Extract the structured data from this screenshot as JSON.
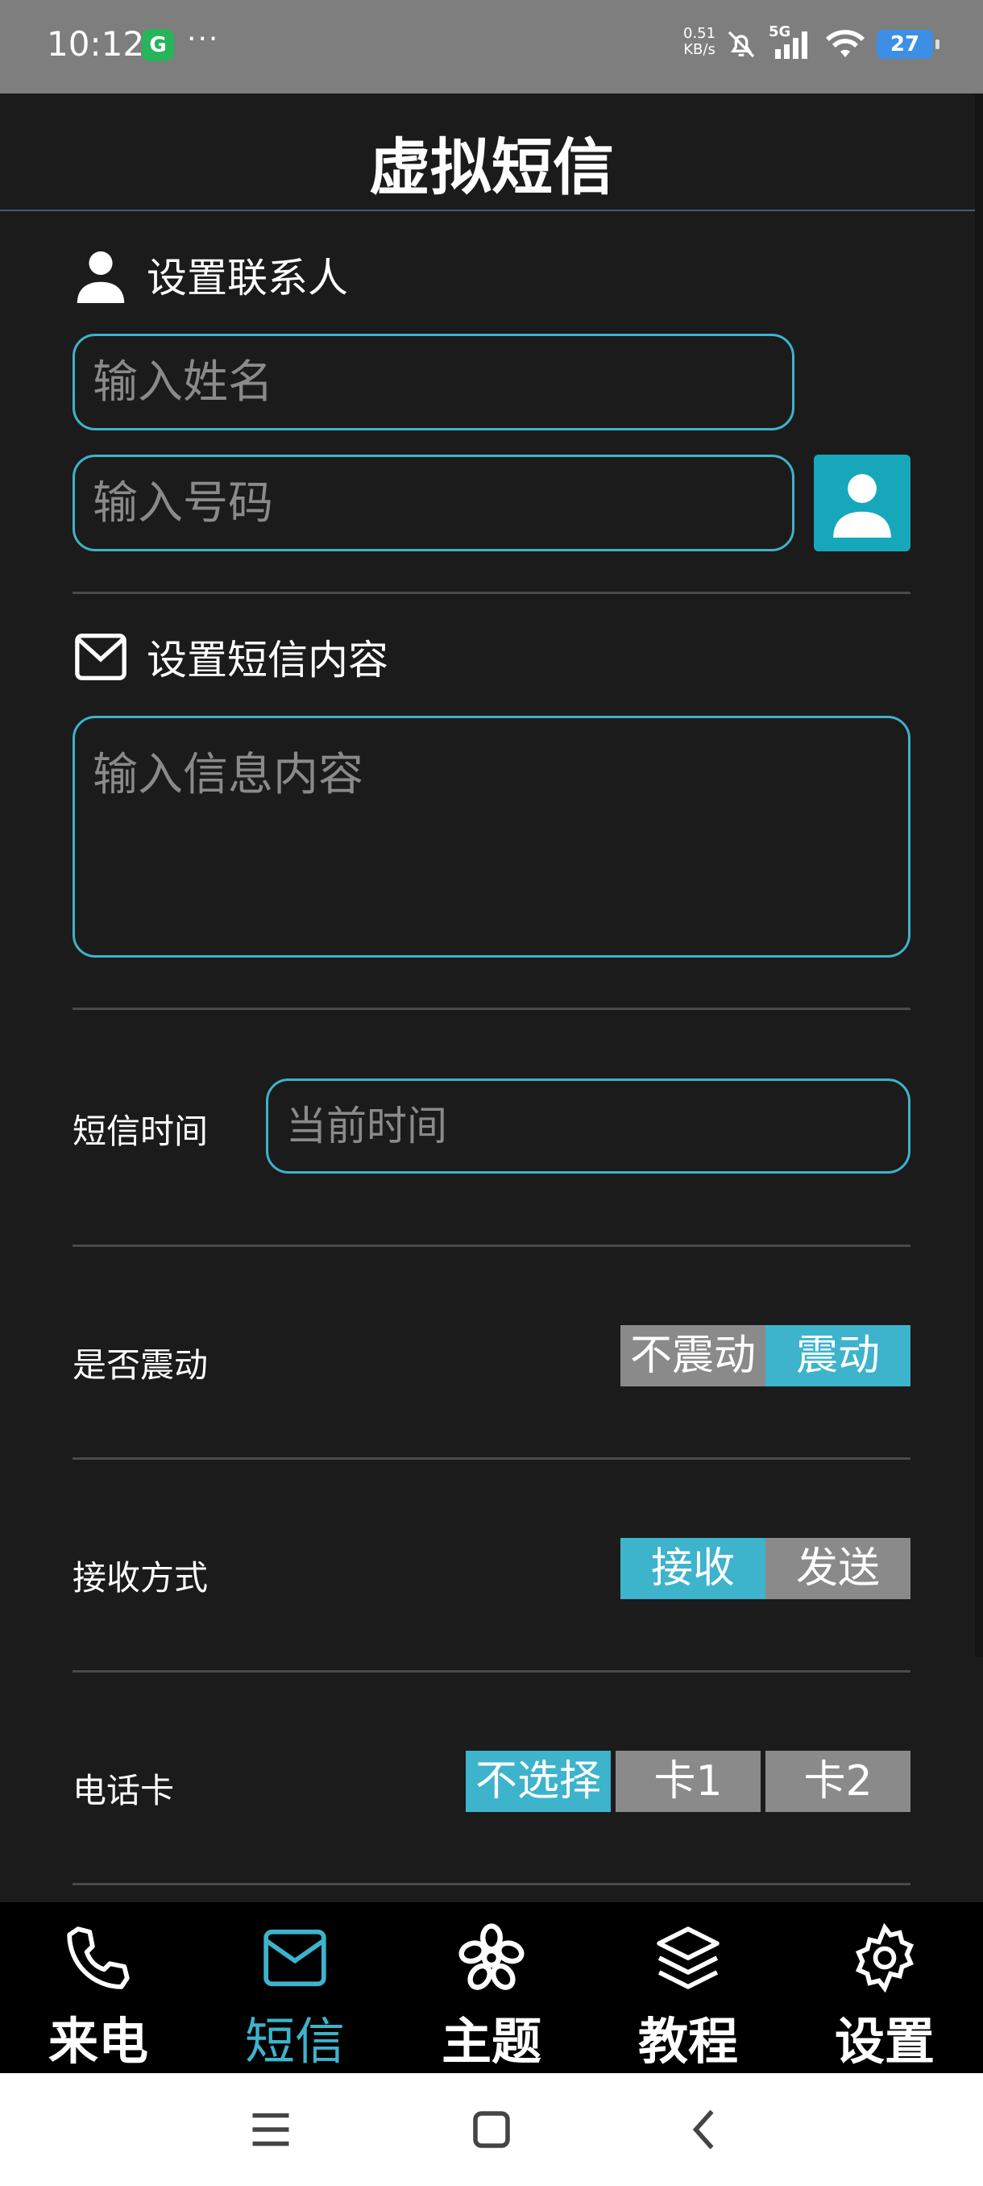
{
  "status": {
    "time": "10:12",
    "app_badge": "G",
    "more": "···",
    "speed_value": "0.51",
    "speed_unit": "KB/s",
    "network": "5G",
    "battery": "27"
  },
  "header": {
    "title": "虚拟短信"
  },
  "contact": {
    "section_label": "设置联系人",
    "name_placeholder": "输入姓名",
    "number_placeholder": "输入号码"
  },
  "message": {
    "section_label": "设置短信内容",
    "content_placeholder": "输入信息内容"
  },
  "time_row": {
    "label": "短信时间",
    "placeholder": "当前时间"
  },
  "vibrate_row": {
    "label": "是否震动",
    "options": [
      "不震动",
      "震动"
    ],
    "selected": "震动"
  },
  "receive_row": {
    "label": "接收方式",
    "options": [
      "接收",
      "发送"
    ],
    "selected": "接收"
  },
  "sim_row": {
    "label": "电话卡",
    "options": [
      "不选择",
      "卡1",
      "卡2"
    ],
    "selected": "不选择"
  },
  "nav": {
    "items": [
      {
        "label": "来电",
        "icon": "phone-icon"
      },
      {
        "label": "短信",
        "icon": "mail-icon"
      },
      {
        "label": "主题",
        "icon": "flower-icon"
      },
      {
        "label": "教程",
        "icon": "layers-icon"
      },
      {
        "label": "设置",
        "icon": "gear-icon"
      }
    ],
    "active": "短信"
  },
  "colors": {
    "accent": "#3db3cc",
    "inactive_option": "#8a8a8a",
    "background": "#1b1b1b",
    "status_bar": "#7e7e7e"
  }
}
